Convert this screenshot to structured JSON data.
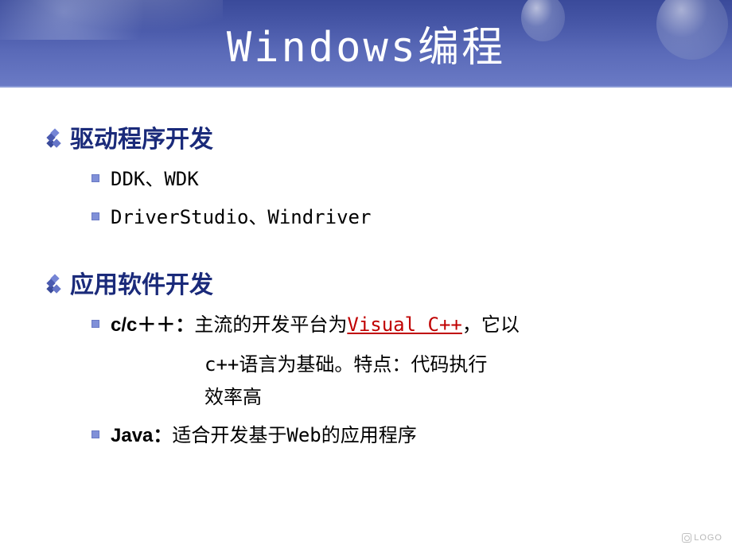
{
  "title": "Windows编程",
  "sections": [
    {
      "heading": "驱动程序开发",
      "items": [
        {
          "text": "DDK、WDK"
        },
        {
          "text": "DriverStudio、Windriver"
        }
      ]
    },
    {
      "heading": "应用软件开发",
      "items": [
        {
          "label": "c/c＋＋：",
          "prefix": "主流的开发平台为",
          "link_text": "Visual C++",
          "suffix": "，它以",
          "cont1": "c++语言为基础。特点：代码执行",
          "cont2": "效率高"
        },
        {
          "label": "Java：",
          "text": "适合开发基于Web的应用程序"
        }
      ]
    }
  ],
  "logo": "LOGO"
}
